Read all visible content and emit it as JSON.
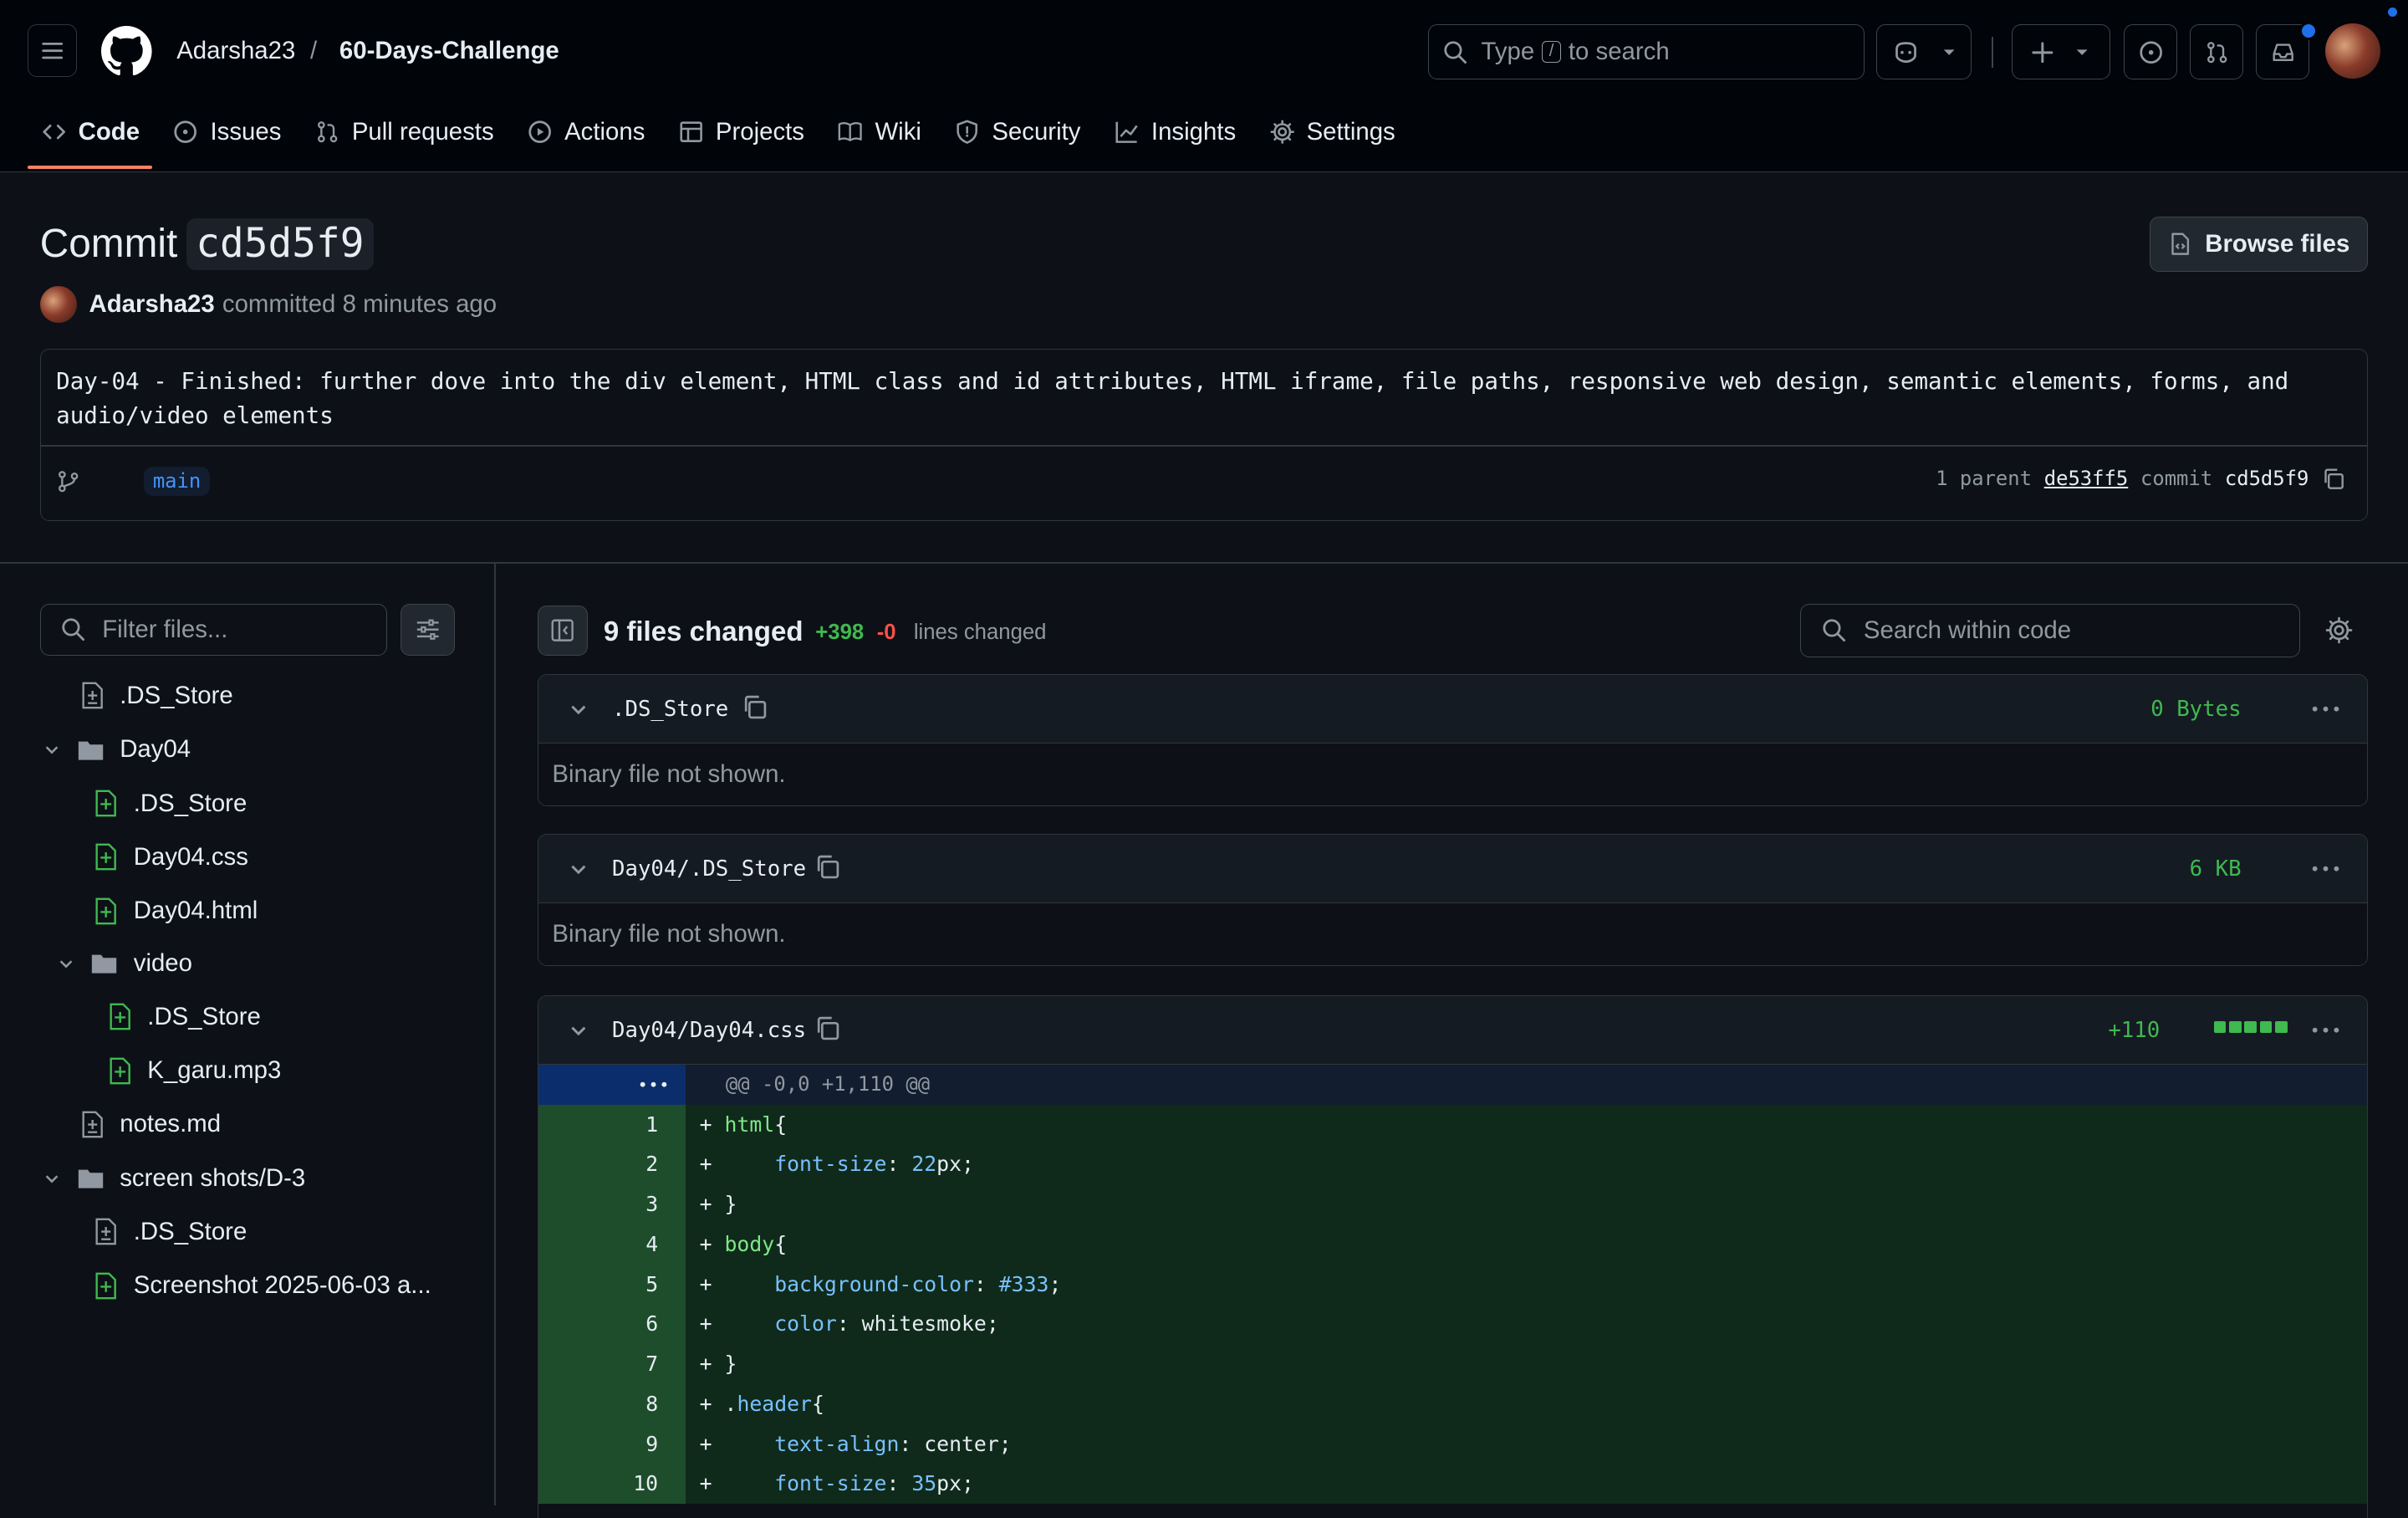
{
  "repo": {
    "owner": "Adarsha23",
    "separator": "/",
    "name": "60-Days-Challenge"
  },
  "search": {
    "prefix": "Type",
    "key": "/",
    "suffix": "to search"
  },
  "tabs": [
    {
      "label": "Code",
      "icon": "code-icon"
    },
    {
      "label": "Issues",
      "icon": "issue-icon"
    },
    {
      "label": "Pull requests",
      "icon": "pull-request-icon"
    },
    {
      "label": "Actions",
      "icon": "play-icon"
    },
    {
      "label": "Projects",
      "icon": "table-icon"
    },
    {
      "label": "Wiki",
      "icon": "book-icon"
    },
    {
      "label": "Security",
      "icon": "shield-icon"
    },
    {
      "label": "Insights",
      "icon": "graph-icon"
    },
    {
      "label": "Settings",
      "icon": "gear-icon"
    }
  ],
  "commit": {
    "title_prefix": "Commit",
    "sha_short": "cd5d5f9",
    "browse_label": "Browse files",
    "author": "Adarsha23",
    "action": "committed",
    "time": "8 minutes ago",
    "message": "Day-04 - Finished: further dove into the div element, HTML class and id attributes, HTML iframe, file paths, responsive web design, semantic elements, forms, and audio/video elements",
    "branch": "main",
    "parent_label": "1 parent",
    "parent_sha": "de53ff5",
    "commit_label": "commit",
    "commit_sha": "cd5d5f9"
  },
  "filter": {
    "placeholder": "Filter files..."
  },
  "tree": [
    {
      "label": ".DS_Store",
      "type": "file-modified"
    },
    {
      "label": "Day04",
      "type": "folder"
    },
    {
      "label": ".DS_Store",
      "type": "file-added"
    },
    {
      "label": "Day04.css",
      "type": "file-added"
    },
    {
      "label": "Day04.html",
      "type": "file-added"
    },
    {
      "label": "video",
      "type": "folder"
    },
    {
      "label": ".DS_Store",
      "type": "file-added"
    },
    {
      "label": "K_garu.mp3",
      "type": "file-added"
    },
    {
      "label": "notes.md",
      "type": "file-modified"
    },
    {
      "label": "screen shots/D-3",
      "type": "folder"
    },
    {
      "label": ".DS_Store",
      "type": "file-modified"
    },
    {
      "label": "Screenshot 2025-06-03 a...",
      "type": "file-added"
    }
  ],
  "summary": {
    "files_changed": "9 files changed",
    "additions": "+398",
    "deletions": "-0",
    "label": "lines changed",
    "code_search_placeholder": "Search within code"
  },
  "files": [
    {
      "name": ".DS_Store",
      "size": "0 Bytes",
      "body": "Binary file not shown."
    },
    {
      "name": "Day04/.DS_Store",
      "size": "6 KB",
      "body": "Binary file not shown."
    },
    {
      "name": "Day04/Day04.css",
      "size": "+110",
      "hunk": "@@ -0,0 +1,110 @@"
    }
  ],
  "code_lines": [
    {
      "n": "1",
      "sign": "+",
      "indent": "",
      "parts": [
        [
          "html",
          "c-sel"
        ],
        [
          "{",
          ""
        ]
      ]
    },
    {
      "n": "2",
      "sign": "+",
      "indent": "    ",
      "parts": [
        [
          "font-size",
          "c-prop"
        ],
        [
          ": ",
          ""
        ],
        [
          "22",
          "c-num"
        ],
        [
          "px;",
          ""
        ]
      ]
    },
    {
      "n": "3",
      "sign": "+",
      "indent": "",
      "parts": [
        [
          "}",
          ""
        ]
      ]
    },
    {
      "n": "4",
      "sign": "+",
      "indent": "",
      "parts": [
        [
          "body",
          "c-sel"
        ],
        [
          "{",
          ""
        ]
      ]
    },
    {
      "n": "5",
      "sign": "+",
      "indent": "    ",
      "parts": [
        [
          "background-color",
          "c-prop"
        ],
        [
          ": ",
          ""
        ],
        [
          "#333",
          "c-num"
        ],
        [
          ";",
          ""
        ]
      ]
    },
    {
      "n": "6",
      "sign": "+",
      "indent": "    ",
      "parts": [
        [
          "color",
          "c-prop"
        ],
        [
          ": whitesmoke;",
          ""
        ]
      ]
    },
    {
      "n": "7",
      "sign": "+",
      "indent": "",
      "parts": [
        [
          "}",
          ""
        ]
      ]
    },
    {
      "n": "8",
      "sign": "+",
      "indent": "",
      "parts": [
        [
          ".",
          ""
        ],
        [
          "header",
          "c-cls"
        ],
        [
          "{",
          ""
        ]
      ]
    },
    {
      "n": "9",
      "sign": "+",
      "indent": "    ",
      "parts": [
        [
          "text-align",
          "c-prop"
        ],
        [
          ": center;",
          ""
        ]
      ]
    },
    {
      "n": "10",
      "sign": "+",
      "indent": "    ",
      "parts": [
        [
          "font-size",
          "c-prop"
        ],
        [
          ": ",
          ""
        ],
        [
          "35",
          "c-num"
        ],
        [
          "px;",
          ""
        ]
      ]
    }
  ],
  "colors": {
    "accent": "#f78166",
    "added": "#3fb950",
    "deleted": "#f85149",
    "link": "#4493f8"
  }
}
